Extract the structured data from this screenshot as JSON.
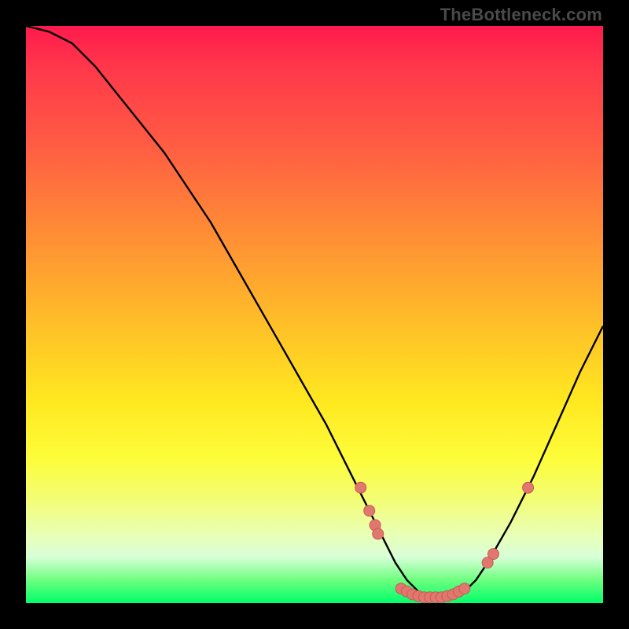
{
  "watermark": "TheBottleneck.com",
  "colors": {
    "frame": "#000000",
    "curve": "#000000",
    "dot_fill": "#e1786f",
    "dot_stroke": "#c75a54"
  },
  "chart_data": {
    "type": "line",
    "title": "",
    "xlabel": "",
    "ylabel": "",
    "xlim": [
      0,
      100
    ],
    "ylim": [
      0,
      100
    ],
    "series": [
      {
        "name": "bottleneck-curve",
        "x": [
          0,
          4,
          8,
          12,
          16,
          20,
          24,
          28,
          32,
          36,
          40,
          44,
          48,
          52,
          56,
          60,
          62,
          64,
          66,
          68,
          70,
          72,
          74,
          76,
          78,
          80,
          84,
          88,
          92,
          96,
          100
        ],
        "y": [
          100,
          99,
          97,
          93,
          88,
          83,
          78,
          72,
          66,
          59,
          52,
          45,
          38,
          31,
          23,
          15,
          11,
          7,
          4,
          2,
          1,
          1,
          1,
          2,
          4,
          7,
          14,
          22,
          31,
          40,
          48
        ]
      }
    ],
    "scatter": [
      {
        "name": "highlight-dots",
        "points": [
          {
            "x": 58,
            "y": 20
          },
          {
            "x": 59.5,
            "y": 16
          },
          {
            "x": 60.5,
            "y": 13.5
          },
          {
            "x": 61,
            "y": 12
          },
          {
            "x": 65,
            "y": 2.5
          },
          {
            "x": 66,
            "y": 2
          },
          {
            "x": 67,
            "y": 1.5
          },
          {
            "x": 68,
            "y": 1.2
          },
          {
            "x": 69,
            "y": 1
          },
          {
            "x": 70,
            "y": 1
          },
          {
            "x": 71,
            "y": 1
          },
          {
            "x": 72,
            "y": 1
          },
          {
            "x": 73,
            "y": 1.2
          },
          {
            "x": 74,
            "y": 1.5
          },
          {
            "x": 75,
            "y": 2
          },
          {
            "x": 76,
            "y": 2.5
          },
          {
            "x": 80,
            "y": 7
          },
          {
            "x": 81,
            "y": 8.5
          },
          {
            "x": 87,
            "y": 20
          }
        ]
      }
    ]
  }
}
